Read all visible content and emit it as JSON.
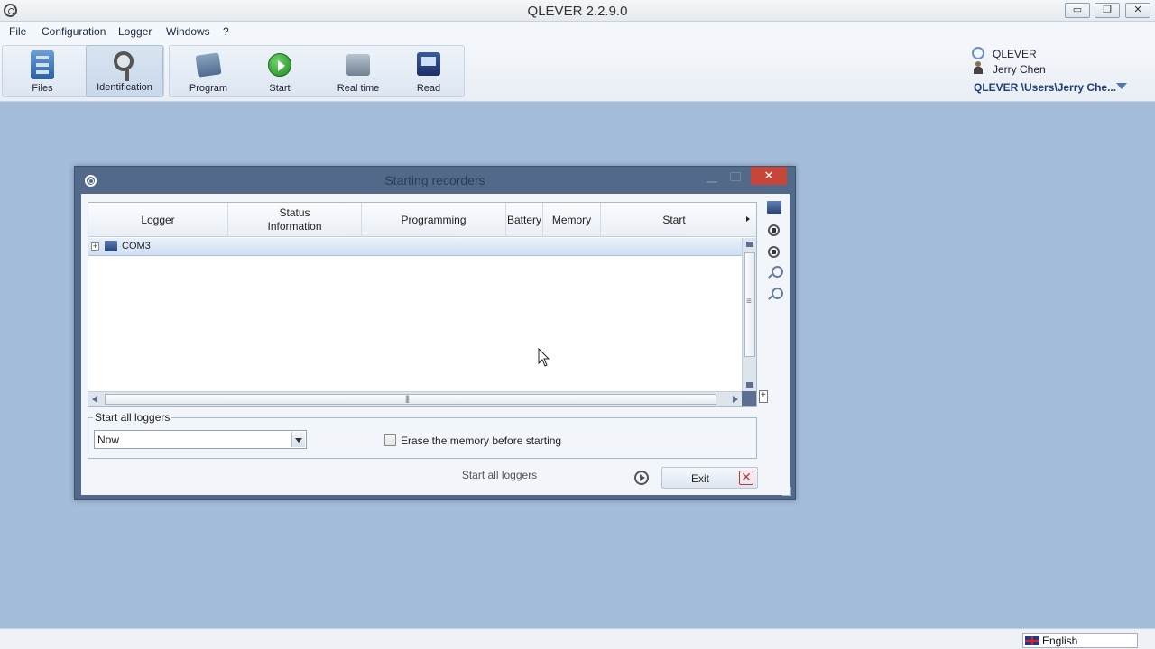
{
  "app": {
    "title": "QLEVER 2.2.9.0",
    "window_buttons": {
      "minimize": "▭",
      "maximize": "❐",
      "close": "✕"
    }
  },
  "menu": [
    "File",
    "Configuration",
    "Logger",
    "Windows",
    "?"
  ],
  "ribbon": {
    "files": "Files",
    "identification": "Identification",
    "program": "Program",
    "start": "Start",
    "realtime": "Real time",
    "read": "Read"
  },
  "user": {
    "org": "QLEVER",
    "name": "Jerry Chen",
    "path": "QLEVER \\Users\\Jerry Che..."
  },
  "dialog": {
    "title": "Starting recorders",
    "close": "✕",
    "columns": [
      "Logger",
      "Status",
      "Information",
      "Programming",
      "Battery",
      "Memory",
      "Start"
    ],
    "rows": [
      {
        "label": "COM3",
        "expander": "+"
      }
    ],
    "start_group": {
      "title": "Start all loggers",
      "when_value": "Now",
      "erase_label": "Erase the memory before starting"
    },
    "start_all_button": "Start all loggers",
    "exit_button": "Exit",
    "exit_icon": "✕"
  },
  "statusbar": {
    "language": "English"
  },
  "icons": {
    "files": "files-icon",
    "identification": "magnifier-icon",
    "program": "program-icon",
    "start": "play-icon",
    "realtime": "realtime-icon",
    "read": "read-icon"
  }
}
